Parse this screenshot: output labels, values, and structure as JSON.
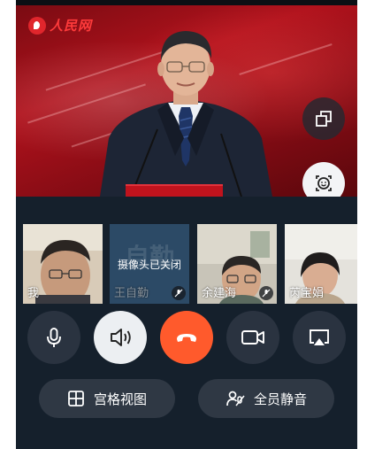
{
  "main_video": {
    "logo_text": "人民网",
    "buttons": {
      "switch_camera_icon": "camera-switch-icon",
      "effects_icon": "face-smile-icon"
    }
  },
  "participants": [
    {
      "name": "我",
      "camera_off": false,
      "muted": false
    },
    {
      "name": "王自勤",
      "camera_off": true,
      "camera_off_text": "摄像头已关闭",
      "avatar_text": "自勤",
      "muted": true
    },
    {
      "name": "余建海",
      "camera_off": false,
      "muted": true
    },
    {
      "name": "芮宝娟",
      "camera_off": false,
      "muted": false
    }
  ],
  "controls": [
    {
      "id": "microphone",
      "icon": "microphone-icon"
    },
    {
      "id": "speaker",
      "icon": "speaker-icon"
    },
    {
      "id": "hang_up",
      "icon": "hang-up-icon"
    },
    {
      "id": "camera",
      "icon": "video-camera-icon"
    },
    {
      "id": "screen_share",
      "icon": "screen-cast-icon"
    }
  ],
  "actions": {
    "grid_view_label": "宫格视图",
    "mute_all_label": "全员静音"
  },
  "colors": {
    "background": "#15202c",
    "hang_up": "#ff5a2c",
    "control_dark": "#2a3340",
    "control_active": "#eceff2",
    "pill": "#2f3844"
  }
}
